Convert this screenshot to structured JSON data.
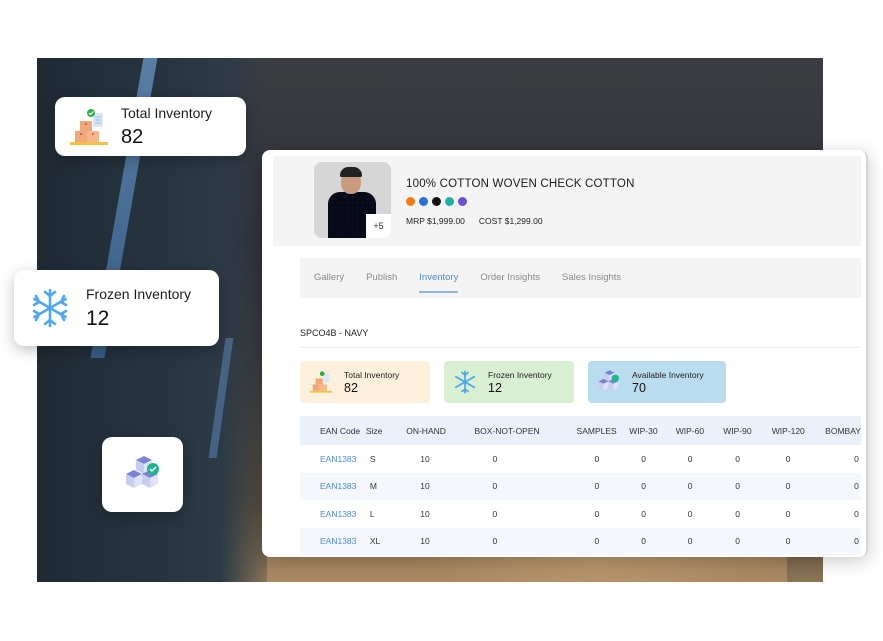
{
  "floating_cards": {
    "total": {
      "label": "Total Inventory",
      "value": "82",
      "icon": "boxes-checklist-icon"
    },
    "frozen": {
      "label": "Frozen Inventory",
      "value": "12",
      "icon": "snowflake-icon"
    },
    "cube": {
      "icon": "cubes-check-icon"
    }
  },
  "product": {
    "title": "100% COTTON WOVEN CHECK COTTON",
    "more_images": "+5",
    "swatches": [
      "#f47a14",
      "#2b6fd9",
      "#111111",
      "#19b3a6",
      "#6c4fd6"
    ],
    "mrp": "MRP $1,999.00",
    "cost": "COST $1,299.00"
  },
  "tabs": [
    {
      "label": "Gallery",
      "active": false
    },
    {
      "label": "Publish",
      "active": false
    },
    {
      "label": "Inventory",
      "active": true
    },
    {
      "label": "Order Insights",
      "active": false
    },
    {
      "label": "Sales Insights",
      "active": false
    }
  ],
  "variant": "SPCO4B - NAVY",
  "stats": {
    "total": {
      "label": "Total Inventory",
      "value": "82"
    },
    "frozen": {
      "label": "Frozen Inventory",
      "value": "12"
    },
    "available": {
      "label": "Available Inventory",
      "value": "70"
    }
  },
  "table": {
    "columns": [
      "EAN Code",
      "Size",
      "ON-HAND",
      "BOX-NOT-OPEN",
      "SAMPLES",
      "WIP-30",
      "WIP-60",
      "WIP-90",
      "WIP-120",
      "BOMBAY"
    ],
    "rows": [
      [
        "EAN1383",
        "S",
        "10",
        "0",
        "0",
        "0",
        "0",
        "0",
        "0",
        "0"
      ],
      [
        "EAN1383",
        "M",
        "10",
        "0",
        "0",
        "0",
        "0",
        "0",
        "0",
        "0"
      ],
      [
        "EAN1383",
        "L",
        "10",
        "0",
        "0",
        "0",
        "0",
        "0",
        "0",
        "0"
      ],
      [
        "EAN1383",
        "XL",
        "10",
        "0",
        "0",
        "0",
        "0",
        "0",
        "0",
        "0"
      ]
    ]
  },
  "colors": {
    "accent": "#4a8ad6",
    "total_bg": "#fdf0dc",
    "frozen_bg": "#d8efd2",
    "available_bg": "#b9ddef",
    "table_header_bg": "#eaf1fb"
  }
}
